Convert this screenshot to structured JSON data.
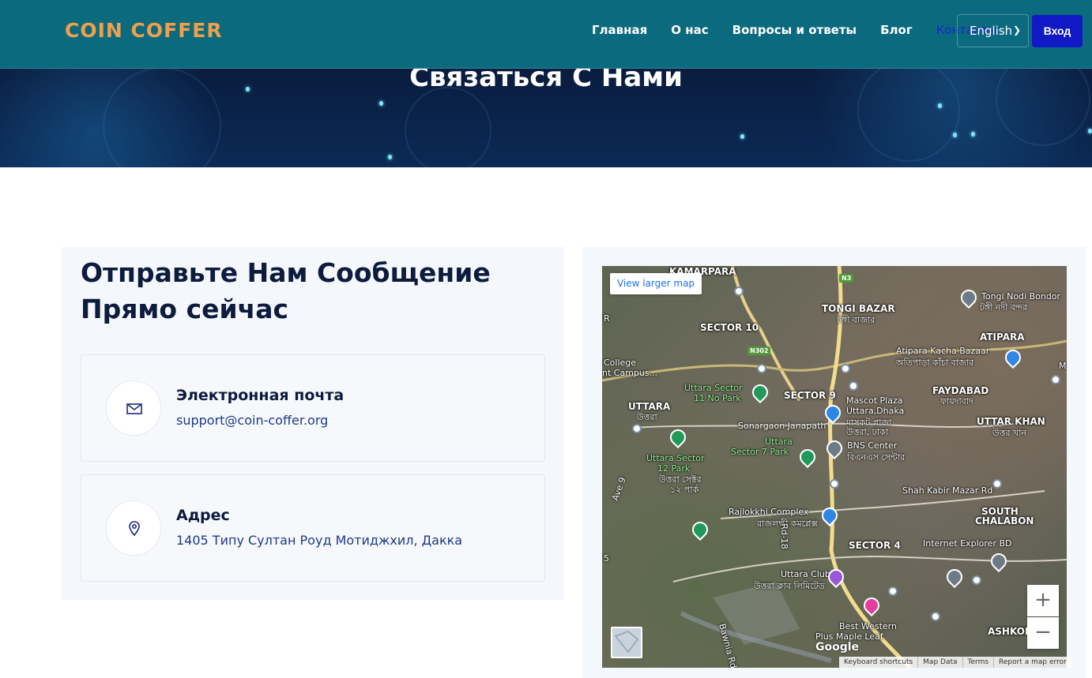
{
  "header": {
    "logo_text": "COIN COFFER",
    "nav": [
      {
        "label": "Главная"
      },
      {
        "label": "О нас"
      },
      {
        "label": "Вопросы и ответы"
      },
      {
        "label": "Блог"
      },
      {
        "label": "Контакты"
      }
    ],
    "language_selected": "English",
    "login_label": "Вход",
    "colors": {
      "topbar": "#0b6a7d",
      "logo": "#f0a04b",
      "active_nav": "#1a24d8",
      "login": "#1119c4"
    }
  },
  "hero": {
    "title": "Связаться С Нами"
  },
  "contact": {
    "section_title": "Отправьте Нам Сообщение Прямо сейчас",
    "cards": [
      {
        "icon": "mail-icon",
        "label": "Электронная почта",
        "value": "support@coin-coffer.org"
      },
      {
        "icon": "location-pin-icon",
        "label": "Адрес",
        "value": "1405 Типу Султан Роуд Мотиджхил, Дакка"
      }
    ]
  },
  "map": {
    "view_larger": "View larger map",
    "zoom_in": "+",
    "zoom_out": "−",
    "google_mark": "Google",
    "footer_links": [
      "Keyboard shortcuts",
      "Map Data",
      "Terms",
      "Report a map error"
    ],
    "labels": [
      {
        "text": "KAMARPARA",
        "small": false
      },
      {
        "text": "TONGI BAZAR",
        "small": false
      },
      {
        "text": "টঙ্গী বাজার",
        "small": true
      },
      {
        "text": "SECTOR 10",
        "small": false
      },
      {
        "text": "Tongi Nodi Bondor",
        "small": true
      },
      {
        "text": "টঙ্গী নদী বন্দর",
        "small": true
      },
      {
        "text": "ATIPARA",
        "small": false
      },
      {
        "text": "Atipara Kacha Bazaar",
        "small": true
      },
      {
        "text": "অতিপাড়া কাঁচা বাজার",
        "small": true
      },
      {
        "text": "College",
        "small": true
      },
      {
        "text": "nt Campus...",
        "small": true
      },
      {
        "text": "Uttara Sector",
        "small": true,
        "green": true
      },
      {
        "text": "11 No Park",
        "small": true,
        "green": true
      },
      {
        "text": "SECTOR 9",
        "small": false
      },
      {
        "text": "Mascot Plaza",
        "small": true
      },
      {
        "text": "Uttara,Dhaka",
        "small": true
      },
      {
        "text": "মাসকট প্লাজা",
        "small": true
      },
      {
        "text": "উত্তরা, ঢাকা",
        "small": true
      },
      {
        "text": "FAYDABAD",
        "small": false
      },
      {
        "text": "ফায়দাবাদ",
        "small": true
      },
      {
        "text": "UTTARA",
        "small": false
      },
      {
        "text": "উত্তরা",
        "small": true
      },
      {
        "text": "Sonargaon Janapath",
        "small": true
      },
      {
        "text": "UTTAR KHAN",
        "small": false
      },
      {
        "text": "উত্তর খান",
        "small": true
      },
      {
        "text": "BNS Center",
        "small": true
      },
      {
        "text": "বিএনএস সেন্টার",
        "small": true
      },
      {
        "text": "Uttara",
        "small": true,
        "green": true
      },
      {
        "text": "Sector 7 Park",
        "small": true,
        "green": true
      },
      {
        "text": "Uttara Sector",
        "small": true,
        "green": true
      },
      {
        "text": "12 Park",
        "small": true,
        "green": true
      },
      {
        "text": "উত্তরা সেক্টর",
        "small": true
      },
      {
        "text": "১২ পার্ক",
        "small": true
      },
      {
        "text": "Shah Kabir Mazar Rd",
        "small": true
      },
      {
        "text": "SOUTH",
        "small": false
      },
      {
        "text": "CHALABON",
        "small": false
      },
      {
        "text": "Rajlokkhi Complex",
        "small": true
      },
      {
        "text": "রাজলক্ষী কমপ্লেক্স",
        "small": true
      },
      {
        "text": "SECTOR 4",
        "small": false
      },
      {
        "text": "Internet Explorer BD",
        "small": true
      },
      {
        "text": "Uttara Club",
        "small": true
      },
      {
        "text": "উত্তরা ক্লাব লিমিটেড",
        "small": true
      },
      {
        "text": "Best Western",
        "small": true
      },
      {
        "text": "Plus Maple Leaf",
        "small": true
      },
      {
        "text": "ASHKONA",
        "small": false
      },
      {
        "text": "Rd-18",
        "small": true
      },
      {
        "text": "Ave 9",
        "small": true
      },
      {
        "text": "Bawnia Rd",
        "small": true
      },
      {
        "text": "M",
        "small": true
      },
      {
        "text": "5",
        "small": true
      },
      {
        "text": "R",
        "small": true
      }
    ],
    "shields": [
      "N3",
      "N302"
    ]
  }
}
